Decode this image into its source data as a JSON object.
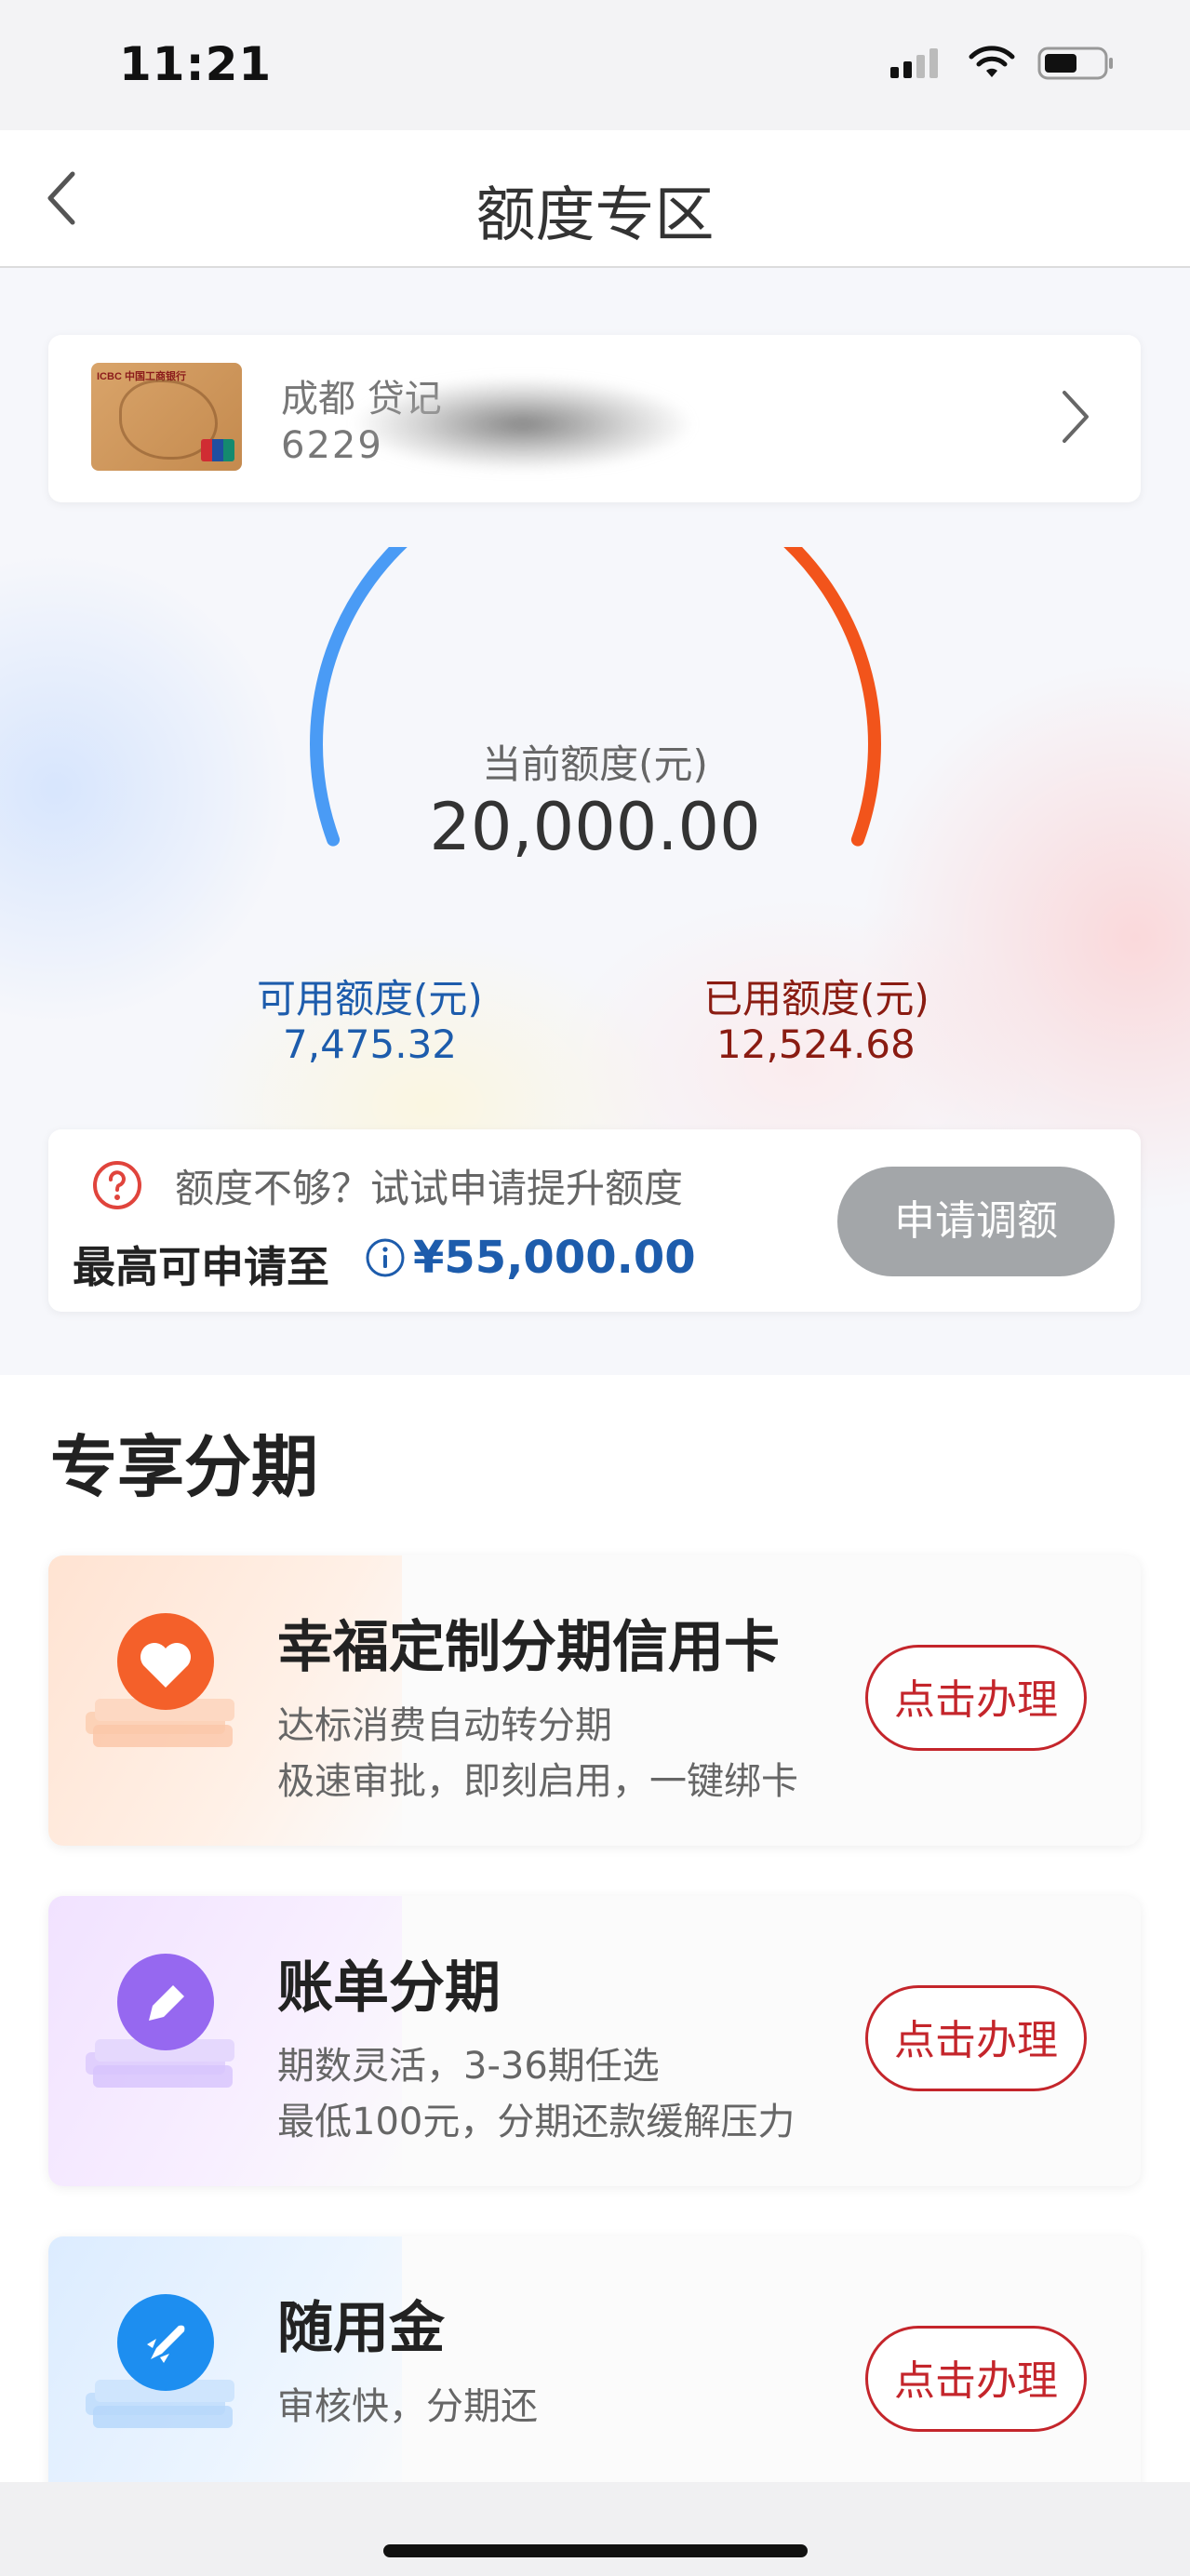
{
  "status_bar": {
    "time": "11:21"
  },
  "header": {
    "title": "额度专区"
  },
  "card": {
    "name": "成都 贷记",
    "number": "6229",
    "thumbnail_brand": "ICBC 中国工商银行"
  },
  "gauge": {
    "label": "当前额度(元)",
    "value": "20,000.00",
    "used_fraction": 0.626,
    "available_color": "#4a9bf5",
    "used_color": "#f2541b"
  },
  "available": {
    "label": "可用额度(元)",
    "value": "7,475.32"
  },
  "used": {
    "label": "已用额度(元)",
    "value": "12,524.68"
  },
  "raise": {
    "prompt": "额度不够？试试申请提升额度",
    "max_label": "最高可申请至",
    "max_value": "¥55,000.00",
    "button": "申请调额"
  },
  "section": {
    "title": "专享分期",
    "items": [
      {
        "title": "幸福定制分期信用卡",
        "desc1": "达标消费自动转分期",
        "desc2": "极速审批，即刻启用，一键绑卡",
        "button": "点击办理",
        "icon": "heart-icon"
      },
      {
        "title": "账单分期",
        "desc1": "期数灵活，3-36期任选",
        "desc2": "最低100元，分期还款缓解压力",
        "button": "点击办理",
        "icon": "pencil-icon"
      },
      {
        "title": "随用金",
        "desc1": "审核快，分期还",
        "desc2": "",
        "button": "点击办理",
        "icon": "rocket-icon"
      }
    ]
  },
  "colors": {
    "accent_blue": "#1d5cac",
    "accent_red": "#c4252b"
  }
}
